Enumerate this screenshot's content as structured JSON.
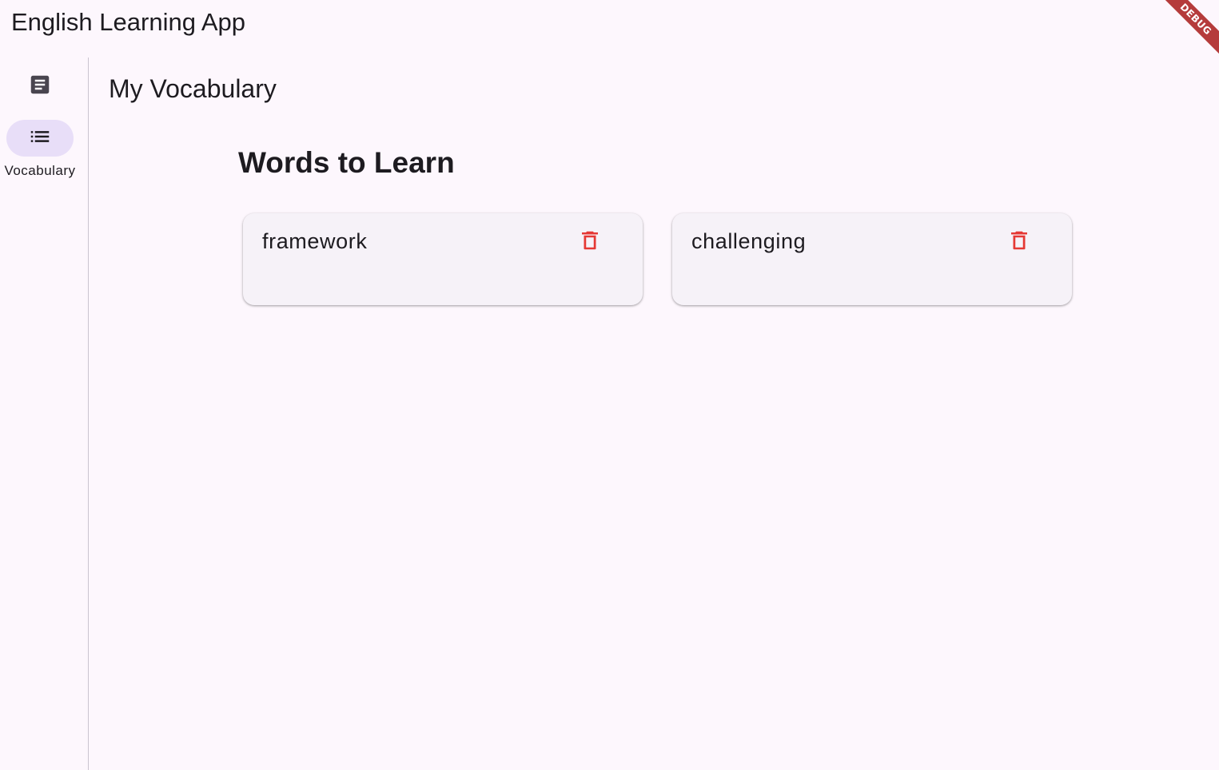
{
  "app": {
    "title": "English Learning App",
    "debug_label": "DEBUG"
  },
  "rail": {
    "items": [
      {
        "icon": "article-icon",
        "label": "",
        "selected": false
      },
      {
        "icon": "list-icon",
        "label": "Vocabulary",
        "selected": true
      }
    ]
  },
  "main": {
    "title": "My Vocabulary",
    "section_title": "Words to Learn",
    "words": [
      {
        "word": "framework",
        "action_icon": "delete-icon"
      },
      {
        "word": "challenging",
        "action_icon": "delete-icon"
      }
    ]
  },
  "colors": {
    "background": "#fdf7fd",
    "indicator": "#e8def8",
    "card": "#f6f2f8",
    "delete": "#e53935",
    "debug_ribbon": "#b53b3b"
  }
}
